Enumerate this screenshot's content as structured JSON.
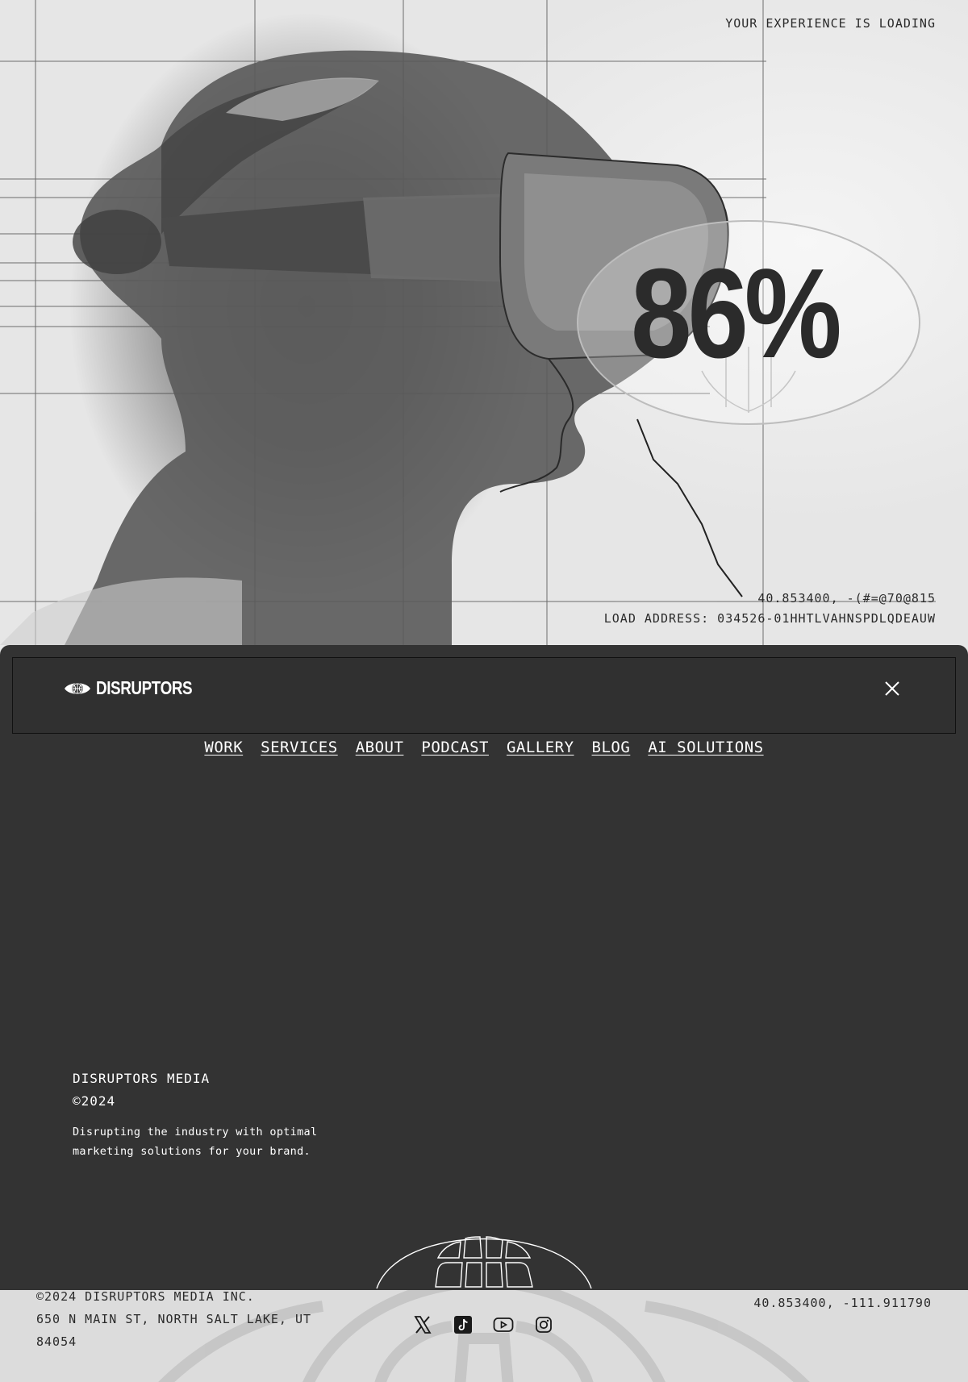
{
  "loader": {
    "status_label": "YOUR EXPERIENCE IS LOADING",
    "progress_text": "86%",
    "progress_value": 86,
    "coordinates": "40.853400, -(#=@70@815",
    "load_address": "LOAD ADDRESS: 034526-01HHTLVAHNSPDLQDEAUW"
  },
  "menu": {
    "brand": "DISRUPTORS",
    "close_icon": "close-icon",
    "nav_items": [
      "WORK",
      "SERVICES",
      "ABOUT",
      "PODCAST",
      "GALLERY",
      "BLOG",
      "AI SOLUTIONS"
    ],
    "company_name": "DISRUPTORS MEDIA",
    "company_year": "©2024",
    "tagline": "Disrupting the industry with optimal marketing solutions for your brand."
  },
  "footer": {
    "copyright": "©2024 DISRUPTORS MEDIA INC.",
    "address": "650 N MAIN ST, NORTH SALT LAKE, UT 84054",
    "coordinates": "40.853400, -111.911790",
    "socials": [
      "x-icon",
      "tiktok-icon",
      "youtube-icon",
      "instagram-icon"
    ]
  },
  "colors": {
    "panel": "#333333",
    "text_light": "#ffffff",
    "text_dark": "#2a2a2a"
  }
}
